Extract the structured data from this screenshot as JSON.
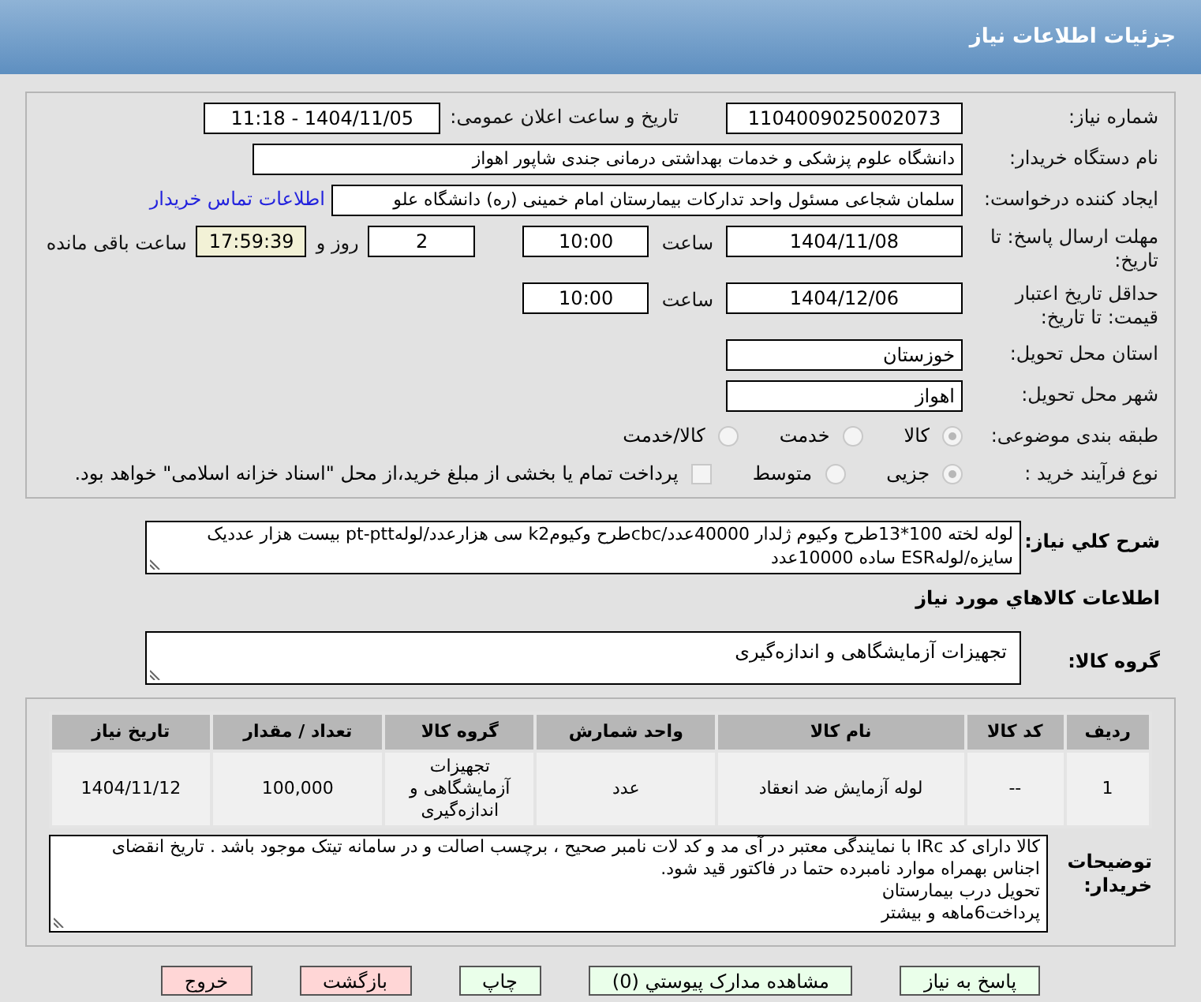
{
  "header": {
    "title": "جزئیات اطلاعات نیاز"
  },
  "need_number": {
    "label": "شماره نیاز:",
    "value": "1104009025002073"
  },
  "announce": {
    "label": "تاریخ و ساعت اعلان عمومی:",
    "value": "1404/11/05 - 11:18"
  },
  "buyer_org": {
    "label": "نام دستگاه خریدار:",
    "value": "دانشگاه علوم پزشکی و خدمات بهداشتی درمانی جندی شاپور اهواز"
  },
  "creator": {
    "label": "ایجاد کننده درخواست:",
    "value": "سلمان شجاعی مسئول واحد تدارکات بیمارستان امام خمینی (ره) دانشگاه علو",
    "link": "اطلاعات تماس خریدار"
  },
  "deadline": {
    "label": "مهلت ارسال پاسخ: تا تاریخ:",
    "date": "1404/11/08",
    "time_label": "ساعت",
    "time": "10:00",
    "days": "2",
    "days_label": "روز و",
    "remaining": "17:59:39",
    "remaining_label": "ساعت باقی مانده"
  },
  "validity": {
    "label": "حداقل تاریخ اعتبار قیمت: تا تاریخ:",
    "date": "1404/12/06",
    "time_label": "ساعت",
    "time": "10:00"
  },
  "province": {
    "label": "استان محل تحویل:",
    "value": "خوزستان"
  },
  "city": {
    "label": "شهر محل تحویل:",
    "value": "اهواز"
  },
  "category": {
    "label": "طبقه بندی موضوعی:",
    "options": [
      {
        "label": "کالا",
        "selected": true
      },
      {
        "label": "خدمت",
        "selected": false
      },
      {
        "label": "کالا/خدمت",
        "selected": false
      }
    ]
  },
  "process": {
    "label": "نوع فرآیند خرید :",
    "options": [
      {
        "label": "جزیی",
        "selected": true
      },
      {
        "label": "متوسط",
        "selected": false
      }
    ],
    "treasury": {
      "checked": false,
      "label": "پرداخت تمام یا بخشی از مبلغ خرید،از محل \"اسناد خزانه اسلامی\" خواهد بود."
    }
  },
  "description": {
    "label": "شرح کلي نیاز:",
    "lines": [
      "لوله لخته 100*13طرح وکیوم ژلدار 40000عدد/cbcطرح وکیومk2  سی هزارعدد/لولهpt-ptt بیست هزار عددیک",
      "سایزه/لولهESR ساده 10000عدد"
    ]
  },
  "goods_heading": "اطلاعات کالاهاي مورد نیاز",
  "goods_group": {
    "label": "گروه کالا:",
    "value": "تجهیزات آزمایشگاهی و اندازه‌گیری"
  },
  "table": {
    "columns": [
      "ردیف",
      "کد کالا",
      "نام کالا",
      "واحد شمارش",
      "گروه کالا",
      "تعداد / مقدار",
      "تاریخ نیاز"
    ],
    "rows": [
      [
        "1",
        "--",
        "لوله آزمایش ضد انعقاد",
        "عدد",
        "تجهیزات آزمایشگاهی و اندازه‌گیری",
        "100,000",
        "1404/11/12"
      ]
    ]
  },
  "buyer_notes": {
    "label": "توضیحات خریدار:",
    "lines": [
      "کالا دارای کد IRc با نمایندگی معتبر در آی مد و کد لات نامبر صحیح ، برچسب اصالت و در سامانه تیتک موجود باشد . تاریخ انقضای اجناس بهمراه موارد نامبرده حتما در فاکتور قید شود.",
      "تحویل درب بیمارستان",
      "پرداخت6ماهه و بیشتر"
    ]
  },
  "buttons": [
    {
      "label": "پاسخ به نیاز",
      "kind": "action"
    },
    {
      "label": "مشاهده مدارک پیوستي (0)",
      "kind": "action"
    },
    {
      "label": "چاپ",
      "kind": "action"
    },
    {
      "label": "بازگشت",
      "kind": "exit"
    },
    {
      "label": "خروج",
      "kind": "exit"
    }
  ]
}
